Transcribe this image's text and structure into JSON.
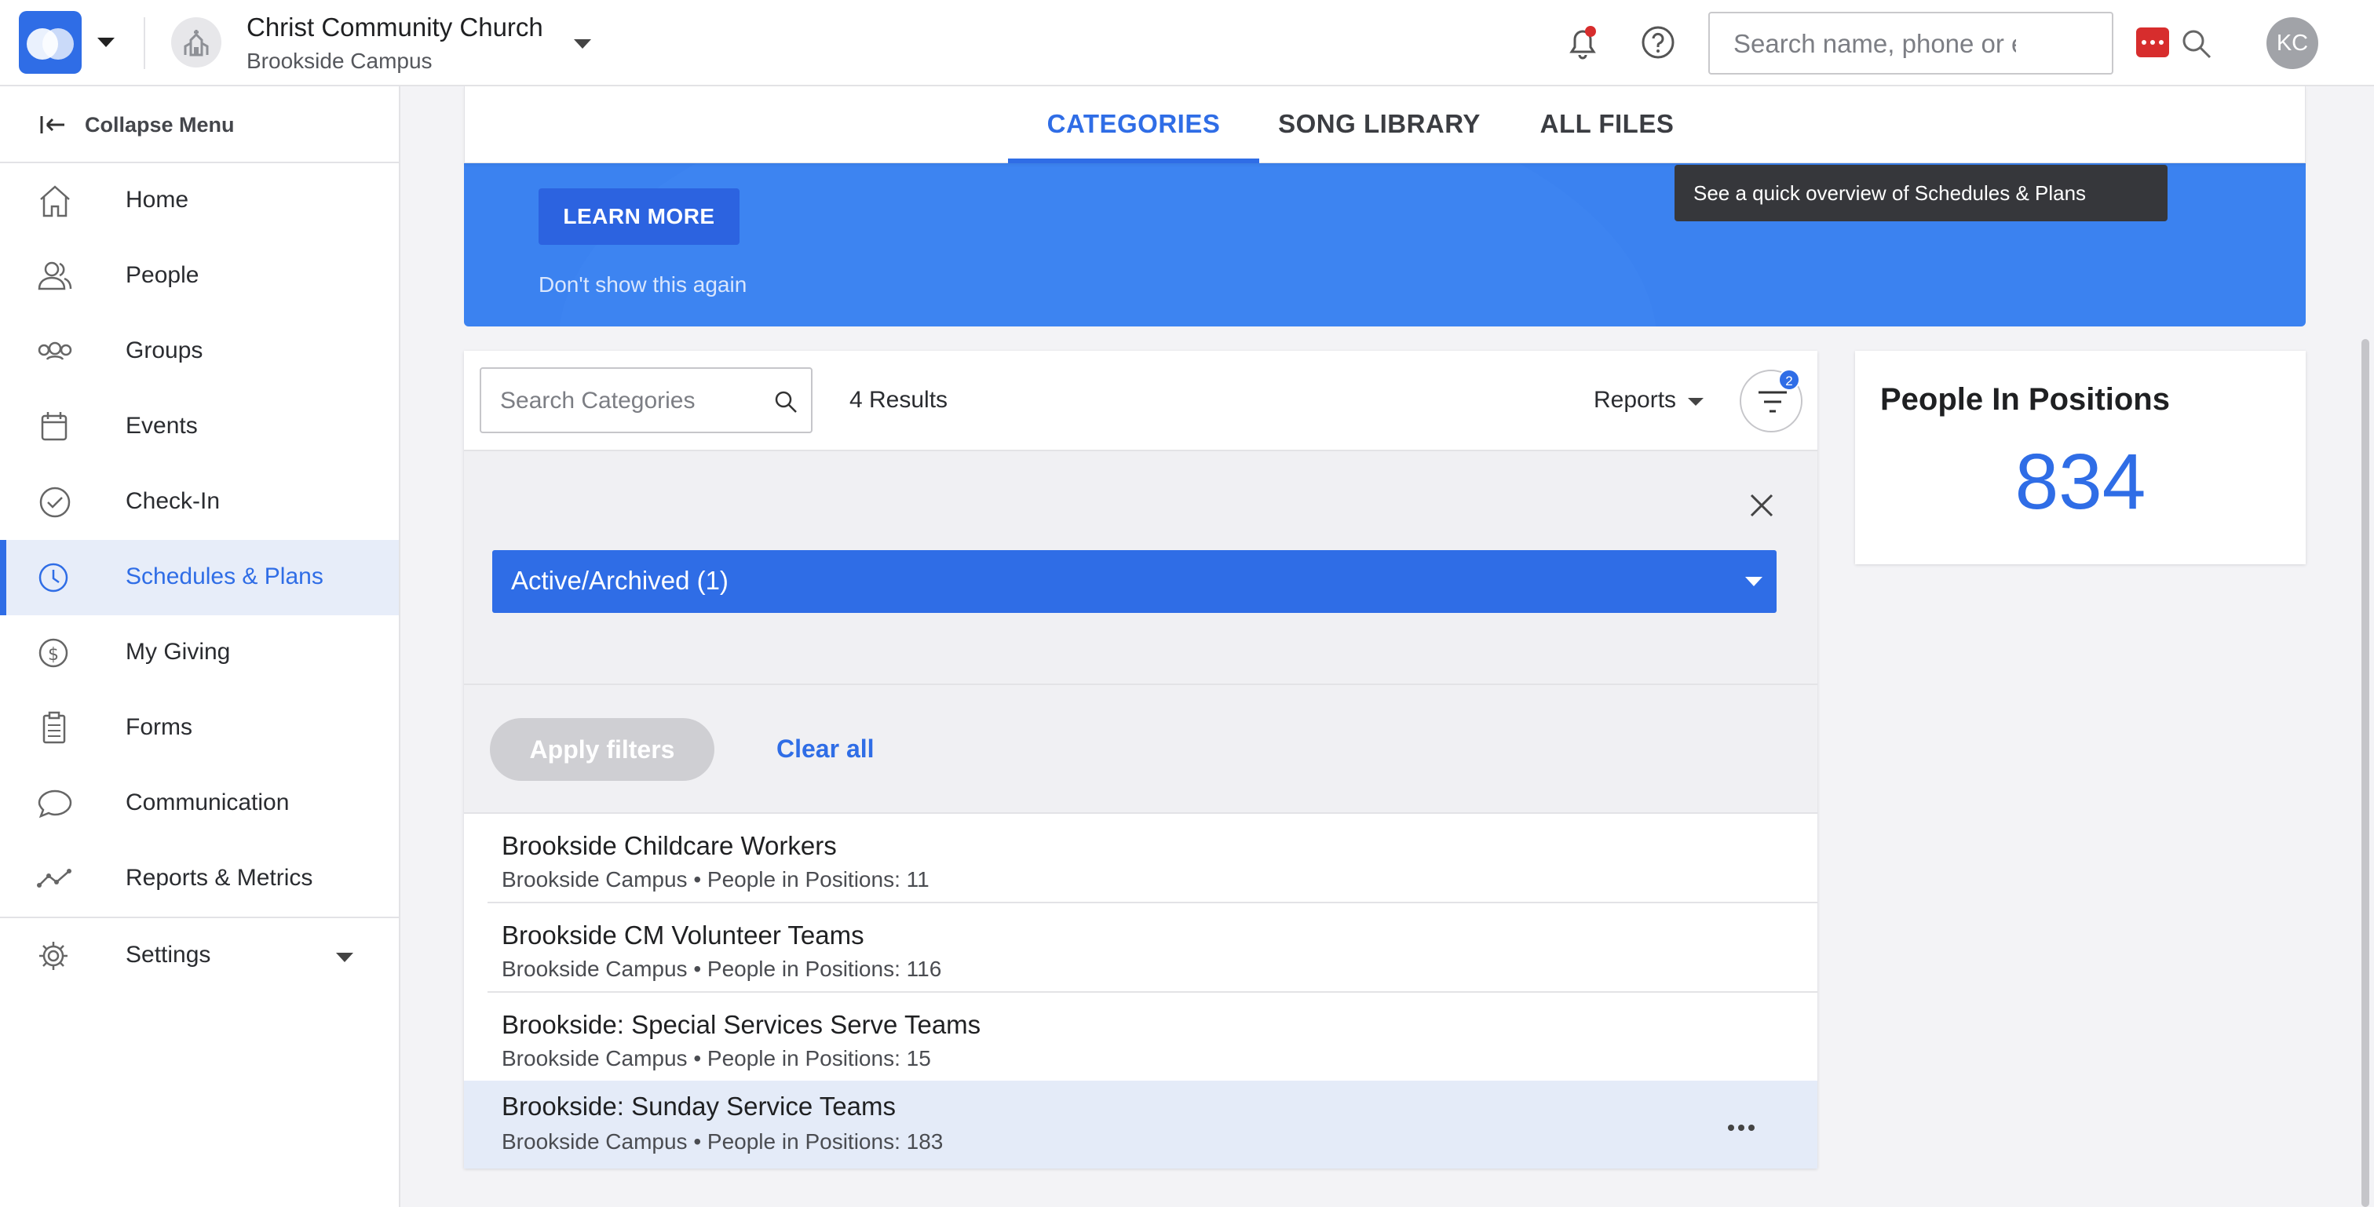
{
  "header": {
    "church_name": "Christ Community Church",
    "campus_name": "Brookside Campus",
    "search_placeholder": "Search name, phone or email",
    "user_initials": "KC"
  },
  "sidebar": {
    "collapse_label": "Collapse Menu",
    "items": [
      {
        "label": "Home",
        "icon": "home-icon"
      },
      {
        "label": "People",
        "icon": "people-icon"
      },
      {
        "label": "Groups",
        "icon": "groups-icon"
      },
      {
        "label": "Events",
        "icon": "calendar-icon"
      },
      {
        "label": "Check-In",
        "icon": "check-circle-icon"
      },
      {
        "label": "Schedules & Plans",
        "icon": "clock-icon",
        "active": true
      },
      {
        "label": "My Giving",
        "icon": "dollar-icon"
      },
      {
        "label": "Forms",
        "icon": "clipboard-icon"
      },
      {
        "label": "Communication",
        "icon": "chat-icon"
      },
      {
        "label": "Reports & Metrics",
        "icon": "metrics-icon"
      }
    ],
    "settings_label": "Settings"
  },
  "tabs": {
    "categories": "CATEGORIES",
    "song_library": "SONG LIBRARY",
    "all_files": "ALL FILES",
    "active": "CATEGORIES"
  },
  "banner": {
    "learn_more": "LEARN MORE",
    "dont_show": "Don't show this again",
    "tooltip": "See a quick overview of Schedules & Plans"
  },
  "categories": {
    "search_placeholder": "Search Categories",
    "results": "4 Results",
    "reports_label": "Reports",
    "filter_count": "2",
    "filter_panel": {
      "active_archived_label": "Active/Archived (1)",
      "apply_label": "Apply filters",
      "clear_label": "Clear all"
    },
    "rows": [
      {
        "title": "Brookside Childcare Workers",
        "subtitle": "Brookside Campus • People in Positions: 11"
      },
      {
        "title": "Brookside CM Volunteer Teams",
        "subtitle": "Brookside Campus • People in Positions: 116"
      },
      {
        "title": "Brookside: Special Services Serve Teams",
        "subtitle": "Brookside Campus • People in Positions: 15"
      },
      {
        "title": "Brookside: Sunday Service Teams",
        "subtitle": "Brookside Campus • People in Positions: 183"
      }
    ]
  },
  "people_in_positions": {
    "title": "People In Positions",
    "value": "834"
  },
  "colors": {
    "accent": "#2f6de6",
    "banner": "#3b82f0",
    "notification_dot": "#d72d2d"
  }
}
